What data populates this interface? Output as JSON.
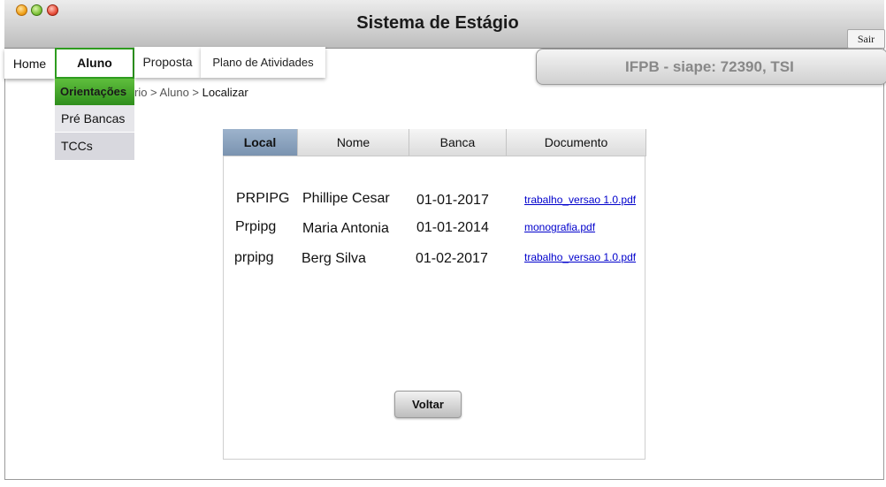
{
  "window": {
    "title": "Sistema de Estágio",
    "logout_label": "Sair"
  },
  "nav": {
    "home": "Home",
    "aluno": "Aluno",
    "proposta": "Proposta",
    "plano": "Plano de Atividades",
    "aluno_dropdown": [
      "Orientações",
      "Pré Bancas",
      "TCCs"
    ]
  },
  "breadcrumb": {
    "prefix": "rio > Aluno > ",
    "current": "Localizar"
  },
  "user_info": "IFPB - siape: 72390, TSI",
  "table": {
    "tabs": [
      "Local",
      "Nome",
      "Banca",
      "Documento"
    ],
    "active_tab": "Local",
    "rows": [
      {
        "local": "PRPIPG",
        "nome": "Phillipe Cesar",
        "data": "01-01-2017",
        "documento": "trabalho_versao 1.0.pdf"
      },
      {
        "local": "Prpipg",
        "nome": "Maria Antonia",
        "data": "01-01-2014",
        "documento": "monografia.pdf"
      },
      {
        "local": "prpipg",
        "nome": "Berg Silva",
        "data": "01-02-2017",
        "documento": "trabalho_versao 1.0.pdf"
      }
    ]
  },
  "back_button": "Voltar",
  "colors": {
    "menu_active_border": "#2e9c1f",
    "dropdown_active": "#4aa82e",
    "tab_active": "#8aa2be",
    "link": "#0000cc"
  }
}
